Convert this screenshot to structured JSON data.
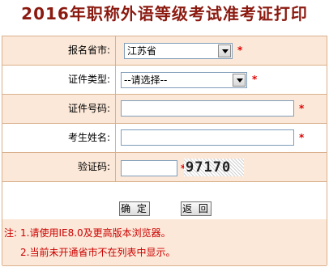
{
  "title": "2016年职称外语等级考试准考证打印",
  "form": {
    "province": {
      "label": "报名省市:",
      "value": "江苏省"
    },
    "id_type": {
      "label": "证件类型:",
      "value": "--请选择--"
    },
    "id_number": {
      "label": "证件号码:",
      "value": ""
    },
    "name": {
      "label": "考生姓名:",
      "value": ""
    },
    "captcha": {
      "label": "验证码:",
      "value": "",
      "image_text": "97170"
    },
    "required_mark": "*"
  },
  "buttons": {
    "confirm": "确 定",
    "back": "返 回"
  },
  "notes": {
    "prefix": "注:",
    "line1": "1.请使用IE8.0及更高版本浏览器。",
    "line2": "2.当前未开通省市不在列表中显示。"
  },
  "colors": {
    "title": "#8b1a10",
    "row_bg": "#fbe8d8",
    "border": "#d9b08c",
    "required": "#e00000",
    "note": "#cc0000"
  }
}
